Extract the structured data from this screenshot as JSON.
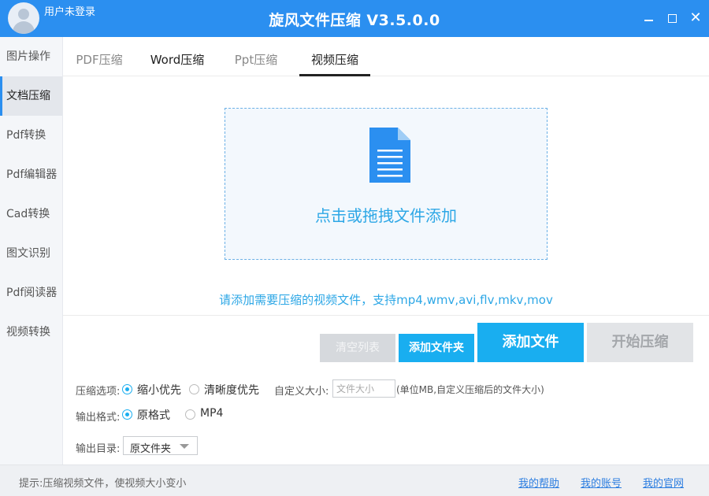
{
  "titlebar": {
    "username": "用户未登录",
    "title": "旋风文件压缩 V3.5.0.0",
    "close_glyph": "✕"
  },
  "sidebar": {
    "items": [
      {
        "label": "图片操作"
      },
      {
        "label": "文档压缩"
      },
      {
        "label": "Pdf转换"
      },
      {
        "label": "Pdf编辑器"
      },
      {
        "label": "Cad转换"
      },
      {
        "label": "图文识别"
      },
      {
        "label": "Pdf阅读器"
      },
      {
        "label": "视频转换"
      }
    ],
    "active_index": 1
  },
  "tabs": [
    {
      "label": "PDF压缩"
    },
    {
      "label": "Word压缩"
    },
    {
      "label": "Ppt压缩"
    },
    {
      "label": "视频压缩"
    }
  ],
  "dropzone": {
    "text": "点击或拖拽文件添加"
  },
  "hint": "请添加需要压缩的视频文件，支持mp4,wmv,avi,flv,mkv,mov",
  "buttons": {
    "clear": "清空列表",
    "add_folder": "添加文件夹",
    "add_file": "添加文件",
    "start": "开始压缩"
  },
  "options": {
    "compress_label": "压缩选项:",
    "compress_small": "缩小优先",
    "compress_clarity": "清晰度优先",
    "custom_size_label": "自定义大小:",
    "custom_size_placeholder": "文件大小",
    "custom_size_note": "(单位MB,自定义压缩后的文件大小)",
    "format_label": "输出格式:",
    "format_original": "原格式",
    "format_mp4": "MP4",
    "output_dir_label": "输出目录:",
    "output_dir_value": "原文件夹"
  },
  "footer": {
    "tip": "提示:压缩视频文件，使视频大小变小",
    "help": "我的帮助",
    "account": "我的账号",
    "site": "我的官网"
  },
  "colors": {
    "titlebar": "#2b8ff0",
    "accent": "#19aef0",
    "link": "#2b7de0"
  }
}
